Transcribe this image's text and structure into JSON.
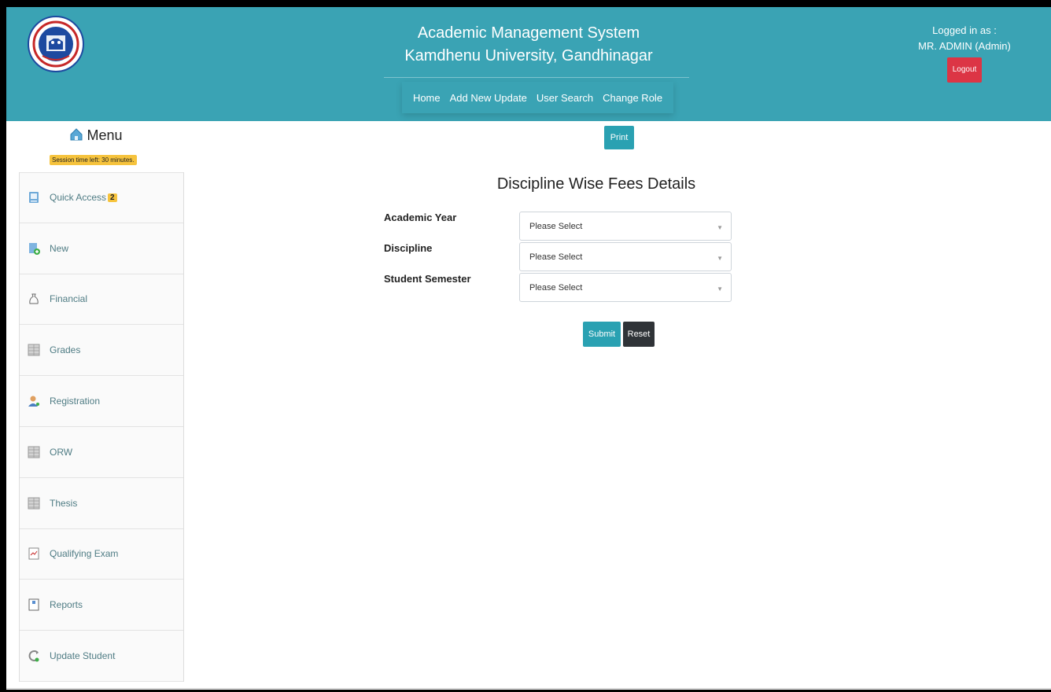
{
  "header": {
    "title_line1": "Academic Management System",
    "title_line2": "Kamdhenu University, Gandhinagar",
    "nav": [
      "Home",
      "Add New Update",
      "User Search",
      "Change Role"
    ],
    "logged_in_label": "Logged in as :",
    "user": "MR. ADMIN (Admin)",
    "logout_label": "Logout"
  },
  "sidebar": {
    "title": "Menu",
    "session": "Session time left: 30 minutes.",
    "items": [
      {
        "label": "Quick Access",
        "badge": "2",
        "icon": "quick-access-icon"
      },
      {
        "label": "New",
        "icon": "new-document-icon"
      },
      {
        "label": "Financial",
        "icon": "money-bag-icon"
      },
      {
        "label": "Grades",
        "icon": "grid-icon"
      },
      {
        "label": "Registration",
        "icon": "user-icon"
      },
      {
        "label": "ORW",
        "icon": "grid-icon"
      },
      {
        "label": "Thesis",
        "icon": "grid-icon"
      },
      {
        "label": "Qualifying Exam",
        "icon": "exam-chart-icon"
      },
      {
        "label": "Reports",
        "icon": "report-icon"
      },
      {
        "label": "Update Student",
        "icon": "update-icon"
      }
    ]
  },
  "main": {
    "print_label": "Print",
    "title": "Discipline Wise Fees Details",
    "fields": [
      {
        "label": "Academic Year",
        "value": "Please Select"
      },
      {
        "label": "Discipline",
        "value": "Please Select"
      },
      {
        "label": "Student Semester",
        "value": "Please Select"
      }
    ],
    "submit_label": "Submit",
    "reset_label": "Reset"
  },
  "colors": {
    "header_bg": "#3aa3b4",
    "primary_button": "#2aa1b2",
    "logout_button": "#dc3545",
    "reset_button": "#2f3337",
    "badge": "#f6c33d"
  }
}
